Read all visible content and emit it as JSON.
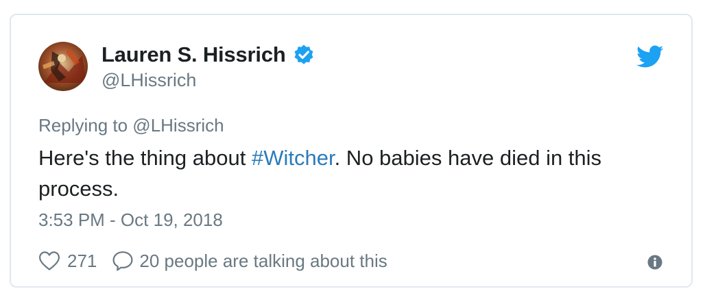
{
  "tweet": {
    "author": {
      "name": "Lauren S. Hissrich",
      "handle": "@LHissrich",
      "verified": true,
      "avatar_icon": "user-avatar-artwork"
    },
    "reply_to": "Replying to @LHissrich",
    "text_before": "Here's the thing about ",
    "hashtag": "#Witcher",
    "text_after": ". No babies have died in this process.",
    "timestamp": "3:53 PM - Oct 19, 2018",
    "likes": "271",
    "replies_label": "20 people are talking about this",
    "icons": {
      "brand": "twitter-bird-icon",
      "like": "heart-outline-icon",
      "reply": "speech-bubble-icon",
      "info": "info-circle-icon",
      "verified": "verified-badge-icon"
    }
  },
  "colors": {
    "twitter_blue": "#1da1f2",
    "hashtag_blue": "#2b7bb9",
    "text_primary": "#1c2022",
    "text_secondary": "#697882",
    "border": "#e1e8ed"
  }
}
